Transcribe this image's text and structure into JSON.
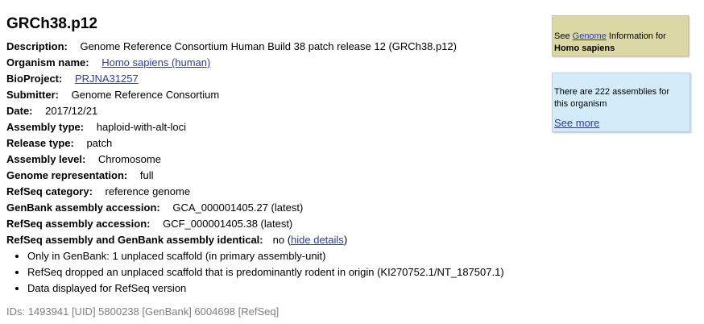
{
  "title": "GRCh38.p12",
  "fields": {
    "description": {
      "label": "Description:",
      "value": "Genome Reference Consortium Human Build 38 patch release 12 (GRCh38.p12)"
    },
    "organism": {
      "label": "Organism name:",
      "value": "Homo sapiens (human)"
    },
    "bioproject": {
      "label": "BioProject:",
      "value": "PRJNA31257"
    },
    "submitter": {
      "label": "Submitter:",
      "value": "Genome Reference Consortium"
    },
    "date": {
      "label": "Date:",
      "value": "2017/12/21"
    },
    "assembly_type": {
      "label": "Assembly type:",
      "value": "haploid-with-alt-loci"
    },
    "release_type": {
      "label": "Release type:",
      "value": "patch"
    },
    "assembly_level": {
      "label": "Assembly level:",
      "value": "Chromosome"
    },
    "genome_representation": {
      "label": "Genome representation:",
      "value": "full"
    },
    "refseq_category": {
      "label": "RefSeq category:",
      "value": "reference genome"
    },
    "genbank_accession": {
      "label": "GenBank assembly accession:",
      "value": "GCA_000001405.27 (latest)"
    },
    "refseq_accession": {
      "label": "RefSeq assembly accession:",
      "value": "GCF_000001405.38 (latest)"
    },
    "identical": {
      "label": "RefSeq assembly and GenBank assembly identical:",
      "value": "no (",
      "link": "hide details",
      "close": ")"
    }
  },
  "details": [
    "Only in GenBank: 1 unplaced scaffold (in primary assembly-unit)",
    "RefSeq dropped an unplaced scaffold that is predominantly rodent in origin (KI270752.1/NT_187507.1)",
    "Data displayed for RefSeq version"
  ],
  "ids": "IDs: 1493941 [UID] 5800238 [GenBank] 6004698 [RefSeq]",
  "sidebar": {
    "genome_box": {
      "prefix": "See ",
      "link": "Genome",
      "suffix": " Information for",
      "organism": "Homo sapiens"
    },
    "assemblies_box": {
      "text": "There are 222 assemblies for this organism",
      "link": "See more"
    }
  }
}
